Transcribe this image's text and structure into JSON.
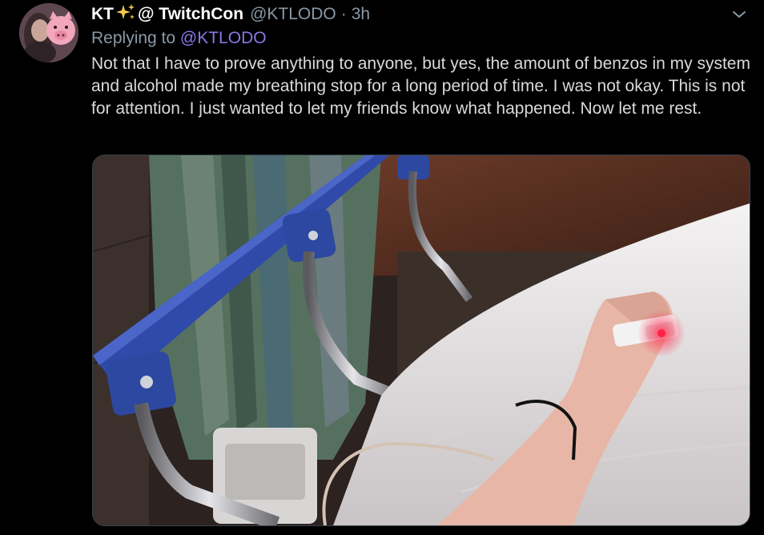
{
  "author": {
    "display_name": "KT",
    "name_suffix": "@ TwitchCon",
    "handle": "@KTLODO",
    "separator": "·",
    "time": "3h"
  },
  "reply": {
    "prefix": "Replying to",
    "to_handle": "@KTLODO"
  },
  "tweet": {
    "text": "Not that I have to prove anything to anyone, but yes, the amount of benzos in my system and alcohol made my breathing stop for a long period of time. I was not okay. This is not for attention. I just wanted to let my friends know what happened. Now let me rest."
  },
  "icons": {
    "sparkle": "sparkles-emoji",
    "menu": "chevron-down-icon"
  },
  "colors": {
    "background": "#000000",
    "text": "#d9d9d9",
    "muted": "#8899a6",
    "accent": "#8c76e6",
    "name": "#ffffff"
  }
}
